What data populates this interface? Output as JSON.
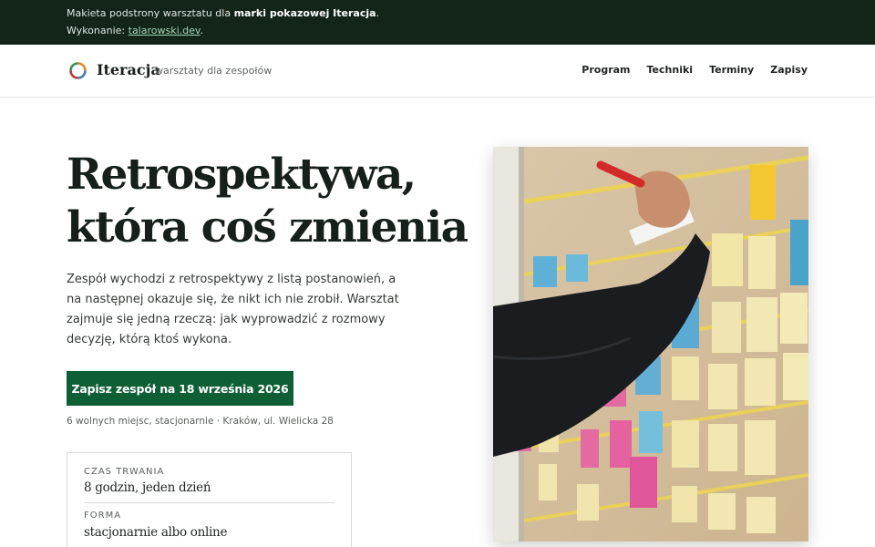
{
  "banner": {
    "line1_prefix": "Makieta podstrony warsztatu dla ",
    "line1_bold": "marki pokazowej Iteracja",
    "line1_suffix": ".",
    "line2_prefix": "Wykonanie: ",
    "line2_link": "talarowski.dev",
    "line2_suffix": "."
  },
  "header": {
    "brand": "Iteracja",
    "tagline": "warsztaty dla zespołów",
    "nav": [
      "Program",
      "Techniki",
      "Terminy",
      "Zapisy"
    ]
  },
  "hero": {
    "title_line1": "Retrospektywa,",
    "title_line2": "która coś zmienia",
    "lead": "Zespół wychodzi z retrospektywy z listą postanowień, a na następnej okazuje się, że nikt ich nie zrobił. Warsztat zajmuje się jedną rzeczą: jak wyprowadzić z rozmowy decyzję, którą ktoś wykona.",
    "cta": "Zapisz zespół na 18 września 2026",
    "meta": "6 wolnych miejsc, stacjonarnie · Kraków, ul. Wielicka 28"
  },
  "facts": [
    {
      "label": "CZAS TRWANIA",
      "value": "8 godzin, jeden dzień"
    },
    {
      "label": "FORMA",
      "value": "stacjonarnie albo online"
    }
  ],
  "colors": {
    "banner_bg": "#132419",
    "accent": "#0e5f35",
    "link": "#9fd5b7"
  },
  "icons": {
    "logo": "ring-logo-icon"
  }
}
